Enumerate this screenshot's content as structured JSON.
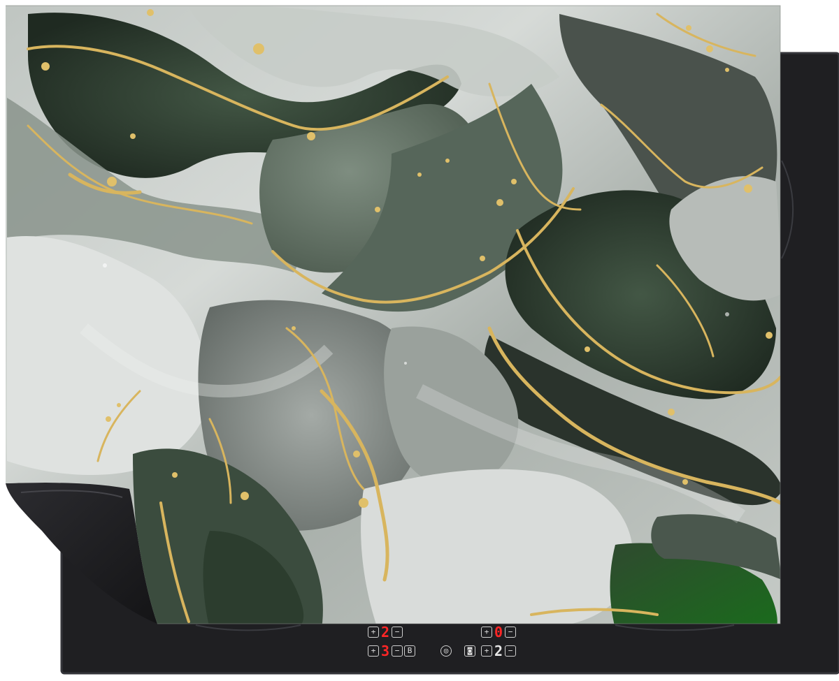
{
  "colors": {
    "cooktop": "#1f1f22",
    "cooktop_edge": "#2f3033",
    "marble_light": "#d2d6d3",
    "marble_dark": "#2e3a2f",
    "gold": "#d8b55e",
    "display_red": "#ff2626",
    "display_white": "#e6e6e6",
    "mat_back": "#1c1c1f"
  },
  "control_panel": {
    "left_top": {
      "minus": "⊟",
      "digit": "2",
      "plus": "⊞"
    },
    "right_top": {
      "minus": "⊟",
      "digit": "0",
      "plus": "⊞"
    },
    "left_bottom": {
      "minus": "⊟",
      "digit": "3",
      "plus": "⊞",
      "boost": "B"
    },
    "power_icon": "power-icon",
    "lock_icon": "lock-icon",
    "right_bottom": {
      "minus": "⊟",
      "digit": "2",
      "plus": "⊞"
    }
  }
}
